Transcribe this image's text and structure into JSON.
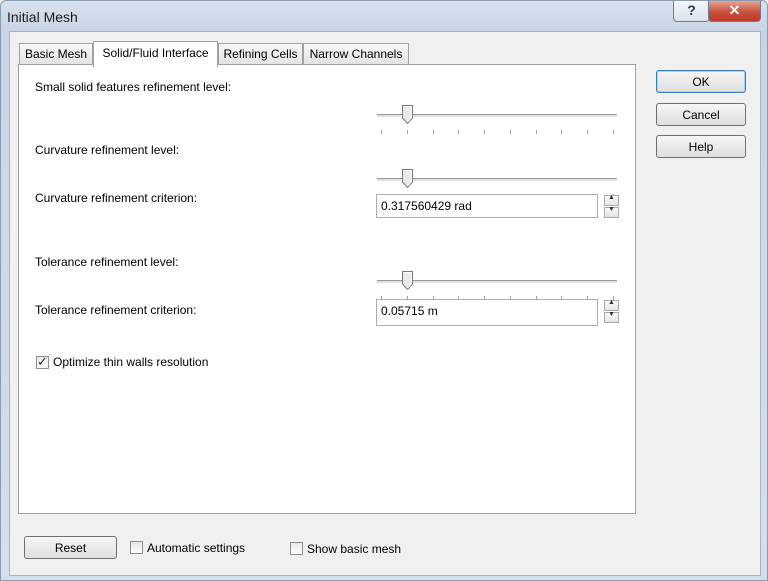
{
  "window": {
    "title": "Initial Mesh",
    "help_glyph": "?",
    "close_glyph": "✕"
  },
  "tabs": [
    {
      "label": "Basic Mesh"
    },
    {
      "label": "Solid/Fluid Interface"
    },
    {
      "label": "Refining Cells"
    },
    {
      "label": "Narrow Channels"
    }
  ],
  "settings": {
    "small_solid": {
      "label": "Small solid features refinement level:",
      "level": 1,
      "max": 9
    },
    "curvature_level": {
      "label": "Curvature refinement level:",
      "level": 1,
      "max": 9
    },
    "curvature_criterion": {
      "label": "Curvature refinement criterion:",
      "value": "0.317560429 rad"
    },
    "tolerance_level": {
      "label": "Tolerance refinement level:",
      "level": 1,
      "max": 9
    },
    "tolerance_criterion": {
      "label": "Tolerance refinement criterion:",
      "value": "0.05715 m"
    },
    "thin_walls": {
      "label": "Optimize thin walls resolution",
      "checked": true
    }
  },
  "buttons": {
    "ok": "OK",
    "cancel": "Cancel",
    "help": "Help",
    "reset": "Reset"
  },
  "bottom": {
    "automatic": {
      "label": "Automatic settings",
      "checked": false
    },
    "show_basic": {
      "label": "Show basic mesh",
      "checked": false
    }
  },
  "icons": {
    "spin_up": "▲",
    "spin_down": "▼",
    "check": "✓"
  }
}
